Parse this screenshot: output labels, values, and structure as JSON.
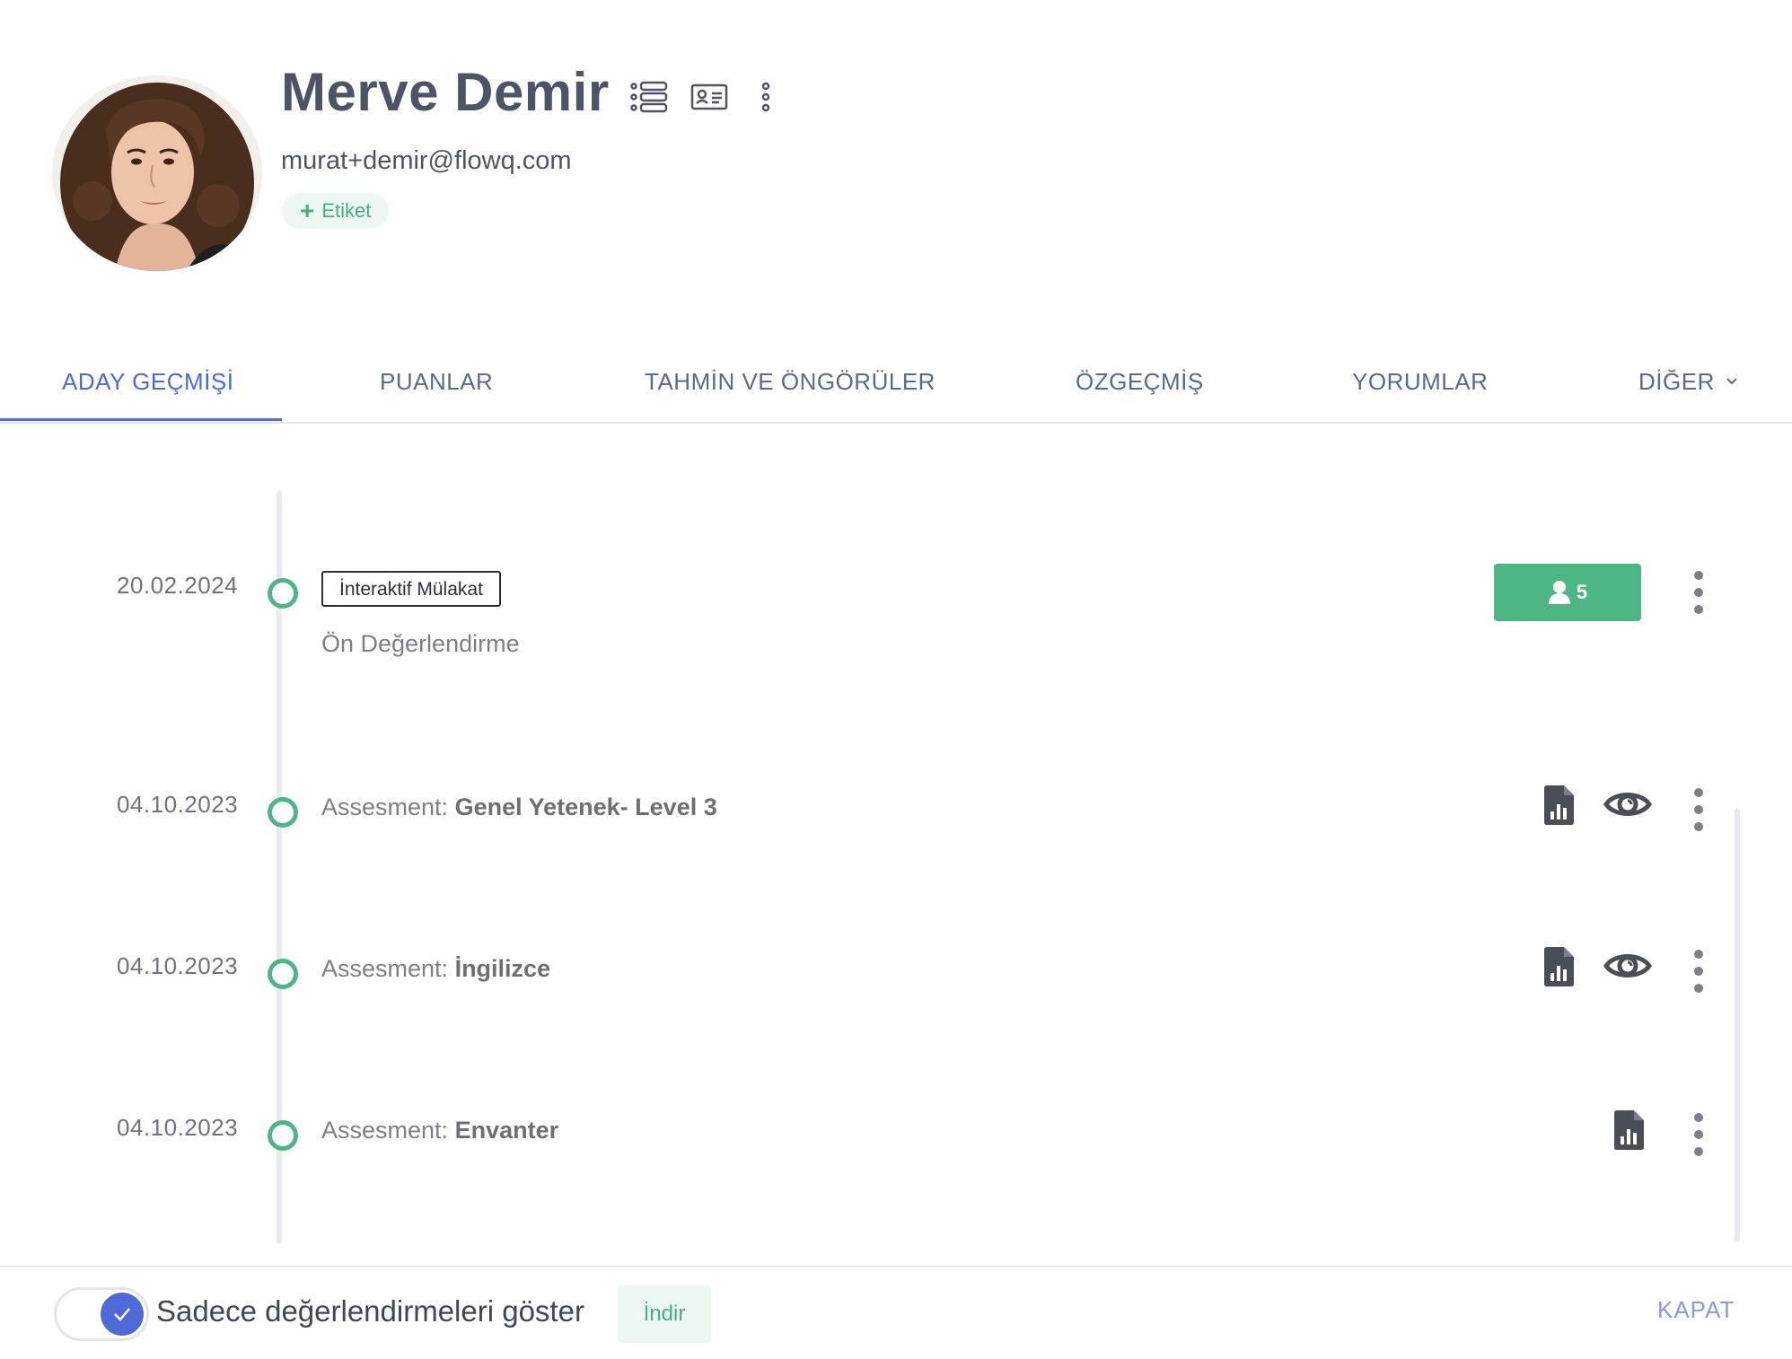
{
  "profile": {
    "name": "Merve Demir",
    "email": "murat+demir@flowq.com",
    "tag_button_label": "Etiket",
    "icons": [
      "list-icon",
      "id-card-icon",
      "more-vertical-icon"
    ]
  },
  "tabs": [
    {
      "label": "ADAY GEÇMİŞİ",
      "active": true
    },
    {
      "label": "PUANLAR"
    },
    {
      "label": "TAHMİN VE ÖNGÖRÜLER"
    },
    {
      "label": "ÖZGEÇMİŞ"
    },
    {
      "label": "YORUMLAR"
    },
    {
      "label": "DİĞER"
    }
  ],
  "timeline": [
    {
      "date": "20.02.2024",
      "badge": "İnteraktif Mülakat",
      "subtitle": "Ön Değerlendirme",
      "participants": "5"
    },
    {
      "date": "04.10.2023",
      "prefix": "Assesment: ",
      "title": "Genel Yetenek- Level 3"
    },
    {
      "date": "04.10.2023",
      "prefix": "Assesment: ",
      "title": "İngilizce"
    },
    {
      "date": "04.10.2023",
      "prefix": "Assesment: ",
      "title": "Envanter"
    }
  ],
  "footer": {
    "toggle_label": "Sadece değerlendirmeleri göster",
    "toggle_on": true,
    "download_label": "İndir",
    "close_label": "KAPAT"
  },
  "colors": {
    "accent": "#4f69d6",
    "green": "#4db685",
    "text": "#4c5466"
  }
}
